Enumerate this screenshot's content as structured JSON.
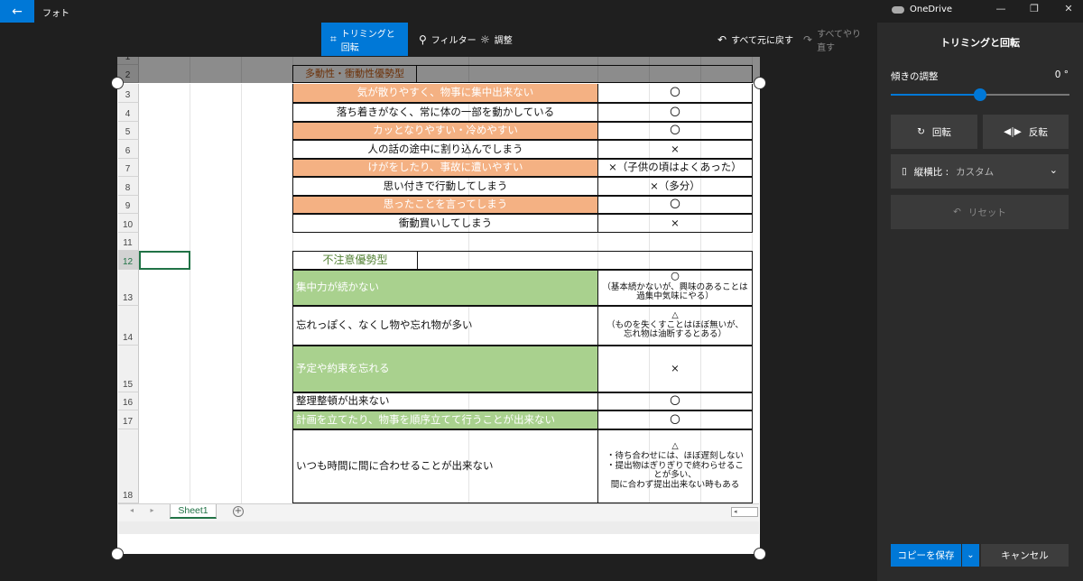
{
  "titlebar": {
    "back_icon": "←",
    "app_title": "フォト",
    "onedrive_label": "OneDrive",
    "minimize": "—",
    "restore": "❐",
    "close": "✕"
  },
  "toolbar": {
    "crop_rotate": "トリミングと回転",
    "filters": "フィルター",
    "adjust": "調整",
    "undo_all": "すべて元に戻す",
    "redo_all": "すべてやり直す"
  },
  "spreadsheet": {
    "row_numbers": [
      "1",
      "2",
      "3",
      "4",
      "5",
      "6",
      "7",
      "8",
      "9",
      "10",
      "11",
      "12",
      "13",
      "14",
      "15",
      "16",
      "17",
      "18"
    ],
    "header_partial": "多動性・衝動性優勢型",
    "hyper_rows": [
      {
        "item": "気が散りやすく、物事に集中出来ない",
        "answer": "〇",
        "color": "orange"
      },
      {
        "item": "落ち着きがなく、常に体の一部を動かしている",
        "answer": "〇",
        "color": "white"
      },
      {
        "item": "カッとなりやすい・冷めやすい",
        "answer": "〇",
        "color": "orange"
      },
      {
        "item": "人の話の途中に割り込んでしまう",
        "answer": "×",
        "color": "white"
      },
      {
        "item": "けがをしたり、事故に遭いやすい",
        "answer": "×（子供の頃はよくあった）",
        "color": "orange"
      },
      {
        "item": "思い付きで行動してしまう",
        "answer": "×（多分）",
        "color": "white"
      },
      {
        "item": "思ったことを言ってしまう",
        "answer": "〇",
        "color": "orange"
      },
      {
        "item": "衝動買いしてしまう",
        "answer": "×",
        "color": "white"
      }
    ],
    "inattentive_header": "不注意優勢型",
    "inattentive_rows": [
      {
        "item": "集中力が続かない",
        "answer_lines": [
          "〇",
          "（基本続かないが、興味のあることは",
          "過集中気味にやる）"
        ],
        "color": "green"
      },
      {
        "item": "忘れっぽく、なくし物や忘れ物が多い",
        "answer_lines": [
          "△",
          "（ものを失くすことはほぼ無いが、",
          "忘れ物は油断するとある）"
        ],
        "color": "white"
      },
      {
        "item": "予定や約束を忘れる",
        "answer_lines": [
          "×"
        ],
        "color": "green"
      },
      {
        "item": "整理整頓が出来ない",
        "answer_lines": [
          "〇"
        ],
        "color": "white"
      },
      {
        "item": "計画を立てたり、物事を順序立てて行うことが出来ない",
        "answer_lines": [
          "〇"
        ],
        "color": "green"
      },
      {
        "item": "いつも時間に間に合わせることが出来ない",
        "answer_lines": [
          "△",
          "・待ち合わせには、ほぼ遅刻しない",
          "・提出物はぎりぎりで終わらせるこ",
          "とが多い、",
          "間に合わず提出出来ない時もある"
        ],
        "color": "white"
      }
    ],
    "sheet_tab": "Sheet1",
    "add_sheet": "+",
    "nav_arrows": "◂ ▸",
    "scroll_glyph": "◂"
  },
  "panel": {
    "title": "トリミングと回転",
    "tilt_label": "傾きの調整",
    "tilt_value": "0 °",
    "tilt_fraction": 0.5,
    "rotate": "回転",
    "flip": "反転",
    "aspect_label": "縦横比 :",
    "aspect_value": "カスタム",
    "reset": "リセット",
    "save_copy": "コピーを保存",
    "cancel": "キャンセル"
  },
  "colors": {
    "accent": "#0078d7",
    "orange_fill": "#f4b183",
    "green_fill": "#a9d18e"
  }
}
